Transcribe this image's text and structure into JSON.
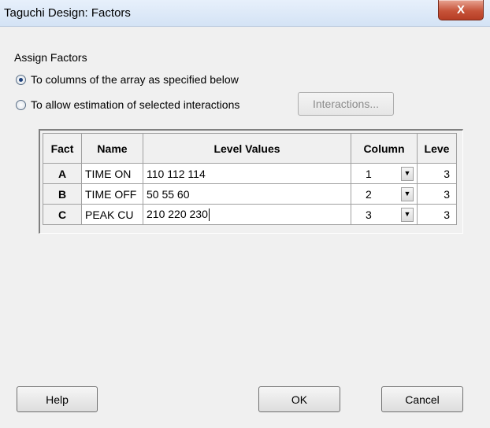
{
  "window": {
    "title": "Taguchi Design: Factors",
    "close_glyph": "X"
  },
  "group_label": "Assign Factors",
  "options": [
    {
      "label": "To columns of the array as specified below",
      "checked": true
    },
    {
      "label": "To allow estimation of selected interactions",
      "checked": false
    }
  ],
  "interactions_button": "Interactions...",
  "table": {
    "headers": {
      "fact": "Fact",
      "name": "Name",
      "levels": "Level Values",
      "column": "Column",
      "leve": "Leve"
    },
    "rows": [
      {
        "fact": "A",
        "name": "TIME ON",
        "levels": "110 112 114",
        "column": "1",
        "leve": "3"
      },
      {
        "fact": "B",
        "name": "TIME OFF",
        "levels": "50 55 60",
        "column": "2",
        "leve": "3"
      },
      {
        "fact": "C",
        "name": "PEAK CU",
        "levels": "210 220 230",
        "column": "3",
        "leve": "3"
      }
    ]
  },
  "buttons": {
    "help": "Help",
    "ok": "OK",
    "cancel": "Cancel"
  }
}
